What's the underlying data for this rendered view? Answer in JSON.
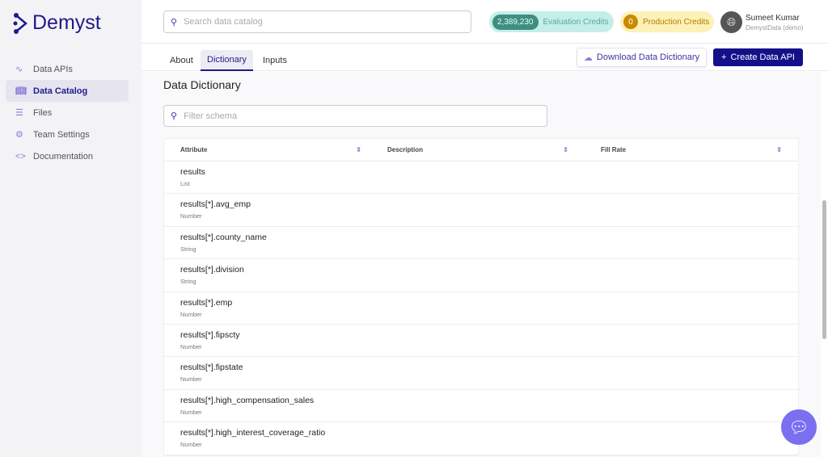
{
  "brand": "Demyst",
  "sidebar": {
    "items": [
      {
        "label": "Data APIs",
        "icon": "activity-icon"
      },
      {
        "label": "Data Catalog",
        "icon": "book-icon"
      },
      {
        "label": "Files",
        "icon": "database-icon"
      },
      {
        "label": "Team Settings",
        "icon": "gear-icon"
      },
      {
        "label": "Documentation",
        "icon": "code-icon"
      }
    ]
  },
  "header": {
    "search_placeholder": "Search data catalog",
    "eval_count": "2,389,230",
    "eval_label": "Evaluation Credits",
    "prod_count": "0",
    "prod_label": "Production Credits",
    "user_name": "Sumeet Kumar",
    "user_org": "DemystData (demo)"
  },
  "tabs": [
    "About",
    "Dictionary",
    "Inputs"
  ],
  "actions": {
    "download": "Download Data Dictionary",
    "create": "Create Data API"
  },
  "page_title": "Data Dictionary",
  "filter_placeholder": "Filter schema",
  "columns": [
    "Attribute",
    "Description",
    "Fill Rate"
  ],
  "rows": [
    {
      "name": "results",
      "type": "List"
    },
    {
      "name": "results[*].avg_emp",
      "type": "Number"
    },
    {
      "name": "results[*].county_name",
      "type": "String"
    },
    {
      "name": "results[*].division",
      "type": "String"
    },
    {
      "name": "results[*].emp",
      "type": "Number"
    },
    {
      "name": "results[*].fipscty",
      "type": "Number"
    },
    {
      "name": "results[*].fipstate",
      "type": "Number"
    },
    {
      "name": "results[*].high_compensation_sales",
      "type": "Number"
    },
    {
      "name": "results[*].high_interest_coverage_ratio",
      "type": "Number"
    }
  ]
}
